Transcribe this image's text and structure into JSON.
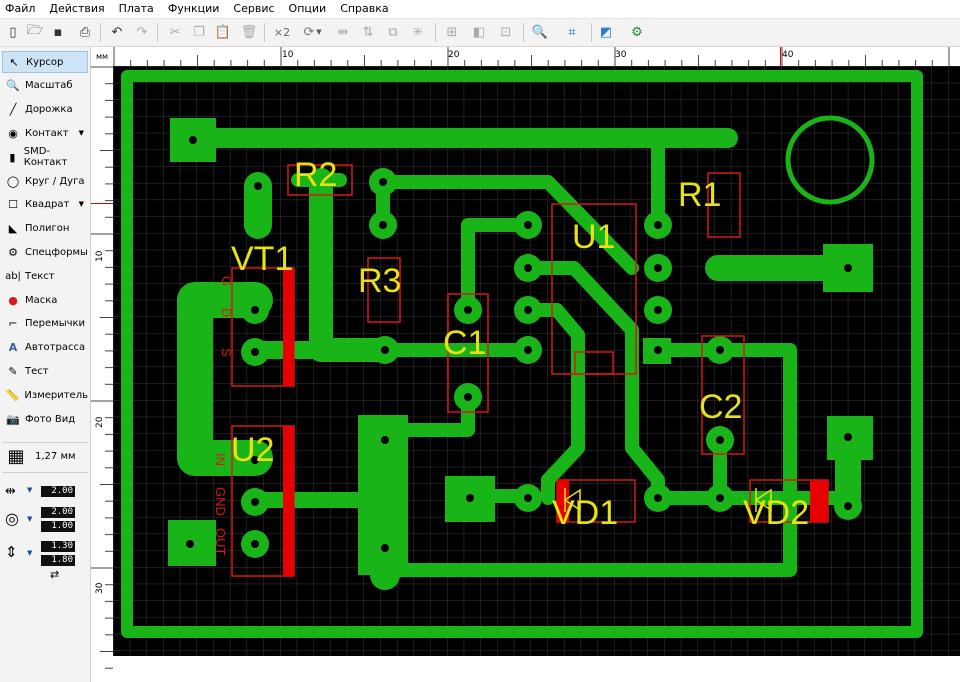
{
  "menu": [
    "Файл",
    "Действия",
    "Плата",
    "Функции",
    "Сервис",
    "Опции",
    "Справка"
  ],
  "toolbar": {
    "zoom_label": "×2"
  },
  "ruler": {
    "unit": "мм",
    "top_ticks": [
      "10",
      "20",
      "30",
      "40"
    ],
    "left_ticks": [
      "10",
      "20",
      "30"
    ]
  },
  "tools": [
    {
      "label": "Курсор",
      "icon": "cursor-icon"
    },
    {
      "label": "Масштаб",
      "icon": "zoom-icon"
    },
    {
      "label": "Дорожка",
      "icon": "track-icon"
    },
    {
      "label": "Контакт",
      "icon": "pad-icon"
    },
    {
      "label": "SMD-Контакт",
      "icon": "smd-pad-icon"
    },
    {
      "label": "Круг / Дуга",
      "icon": "circle-icon"
    },
    {
      "label": "Квадрат",
      "icon": "square-icon"
    },
    {
      "label": "Полигон",
      "icon": "polygon-icon"
    },
    {
      "label": "Спецформы",
      "icon": "special-forms-icon"
    },
    {
      "label": "Текст",
      "icon": "text-icon"
    },
    {
      "label": "Маска",
      "icon": "mask-icon"
    },
    {
      "label": "Перемычки",
      "icon": "jumper-icon"
    },
    {
      "label": "Автотрасса",
      "icon": "autoroute-icon"
    },
    {
      "label": "Тест",
      "icon": "test-icon"
    },
    {
      "label": "Измеритель",
      "icon": "ruler-icon"
    },
    {
      "label": "Фото Вид",
      "icon": "photo-view-icon"
    }
  ],
  "grid": {
    "label": "1,27 мм"
  },
  "params": {
    "track_width": "2.00",
    "pad_outer": "2.00",
    "pad_inner": "1.00",
    "smd_w": "1.30",
    "smd_h": "1.80"
  },
  "colors": {
    "board_bg": "#000000",
    "copper": "#18b418",
    "silk": "#e8e214",
    "part_outline": "#d51818",
    "grid": "#3a3a3a"
  },
  "board": {
    "components": [
      "R2",
      "R1",
      "R3",
      "U1",
      "VT1",
      "C1",
      "C2",
      "U2",
      "VD1",
      "VD2"
    ],
    "pin_labels_vt1": [
      "G",
      "D",
      "S"
    ],
    "pin_labels_u2": [
      "IN",
      "GND",
      "OUT"
    ]
  }
}
